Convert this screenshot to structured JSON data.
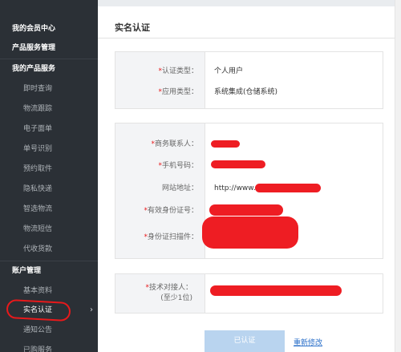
{
  "sidebar": {
    "items": [
      {
        "label": "我的会员中心",
        "kind": "head"
      },
      {
        "label": "产品服务管理",
        "kind": "head"
      },
      {
        "label": "我的产品服务",
        "kind": "head"
      },
      {
        "label": "即时查询",
        "kind": "sub"
      },
      {
        "label": "物流跟踪",
        "kind": "sub"
      },
      {
        "label": "电子面单",
        "kind": "sub"
      },
      {
        "label": "单号识别",
        "kind": "sub"
      },
      {
        "label": "预约取件",
        "kind": "sub"
      },
      {
        "label": "隐私快递",
        "kind": "sub"
      },
      {
        "label": "智选物流",
        "kind": "sub"
      },
      {
        "label": "物流短信",
        "kind": "sub"
      },
      {
        "label": "代收货款",
        "kind": "sub"
      },
      {
        "label": "账户管理",
        "kind": "head"
      },
      {
        "label": "基本资料",
        "kind": "sub"
      },
      {
        "label": "实名认证",
        "kind": "sub",
        "active": true
      },
      {
        "label": "通知公告",
        "kind": "sub"
      },
      {
        "label": "已购服务",
        "kind": "sub"
      }
    ],
    "active_arrow": "›"
  },
  "page": {
    "title": "实名认证"
  },
  "panel1": {
    "rows": [
      {
        "label": "认证类型：",
        "value": "个人用户"
      },
      {
        "label": "应用类型：",
        "value": "系统集成(仓储系统)"
      }
    ]
  },
  "panel2": {
    "rows": [
      {
        "label": "商务联系人：",
        "required": true
      },
      {
        "label": "手机号码：",
        "required": true
      },
      {
        "label": "网站地址：",
        "required": false,
        "value": "http://www."
      },
      {
        "label": "有效身份证号：",
        "required": true
      },
      {
        "label": "身份证扫描件：",
        "required": true
      }
    ]
  },
  "panel3": {
    "label_line1": "技术对接人：",
    "label_line2": "(至少1位)"
  },
  "required_mark": "*",
  "footer": {
    "primary_button": "已认证",
    "secondary_link": "重新修改"
  },
  "colors": {
    "sidebar_bg": "#2b3036",
    "redaction": "#ee1d23",
    "link": "#2a6fc9",
    "button_bg": "#b9d4ef"
  }
}
